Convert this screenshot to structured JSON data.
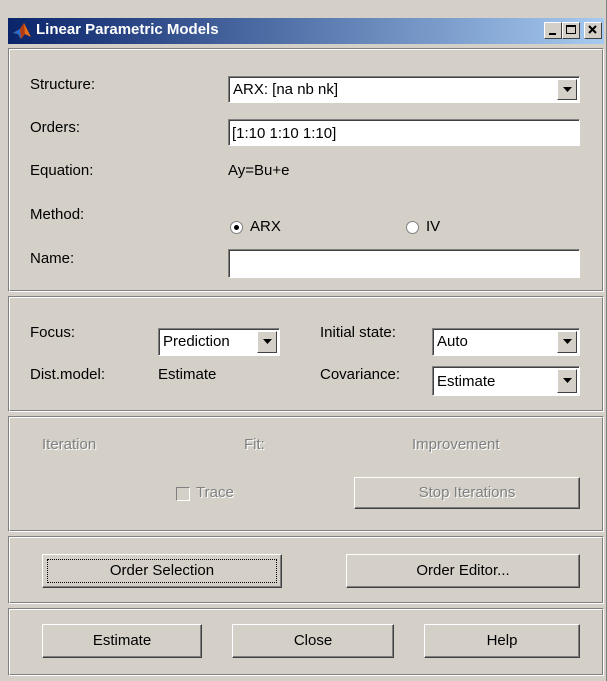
{
  "window": {
    "title": "Linear Parametric Models",
    "icon": "matlab-logo-icon",
    "controls": [
      "minimize-icon",
      "maximize-icon",
      "close-icon"
    ]
  },
  "structure": {
    "label": "Structure:",
    "value": "ARX: [na nb nk]"
  },
  "orders": {
    "label": "Orders:",
    "value": "[1:10 1:10 1:10]"
  },
  "equation": {
    "label": "Equation:",
    "value": "Ay=Bu+e"
  },
  "method": {
    "label": "Method:",
    "options": [
      {
        "label": "ARX",
        "selected": true
      },
      {
        "label": "IV",
        "selected": false
      }
    ]
  },
  "name": {
    "label": "Name:",
    "value": ""
  },
  "focus": {
    "label": "Focus:",
    "value": "Prediction"
  },
  "initial_state": {
    "label": "Initial state:",
    "value": "Auto"
  },
  "dist_model": {
    "label": "Dist.model:",
    "value": "Estimate"
  },
  "covariance": {
    "label": "Covariance:",
    "value": "Estimate"
  },
  "iteration": {
    "iteration_label": "Iteration",
    "fit_label": "Fit:",
    "improvement_label": "Improvement",
    "trace_label": "Trace",
    "stop_label": "Stop Iterations"
  },
  "order": {
    "selection_label": "Order Selection",
    "editor_label": "Order Editor..."
  },
  "actions": {
    "estimate_label": "Estimate",
    "close_label": "Close",
    "help_label": "Help"
  },
  "colors": {
    "titlebar_start": "#0a246a",
    "titlebar_end": "#a6caf0",
    "face": "#d4d0c8"
  }
}
